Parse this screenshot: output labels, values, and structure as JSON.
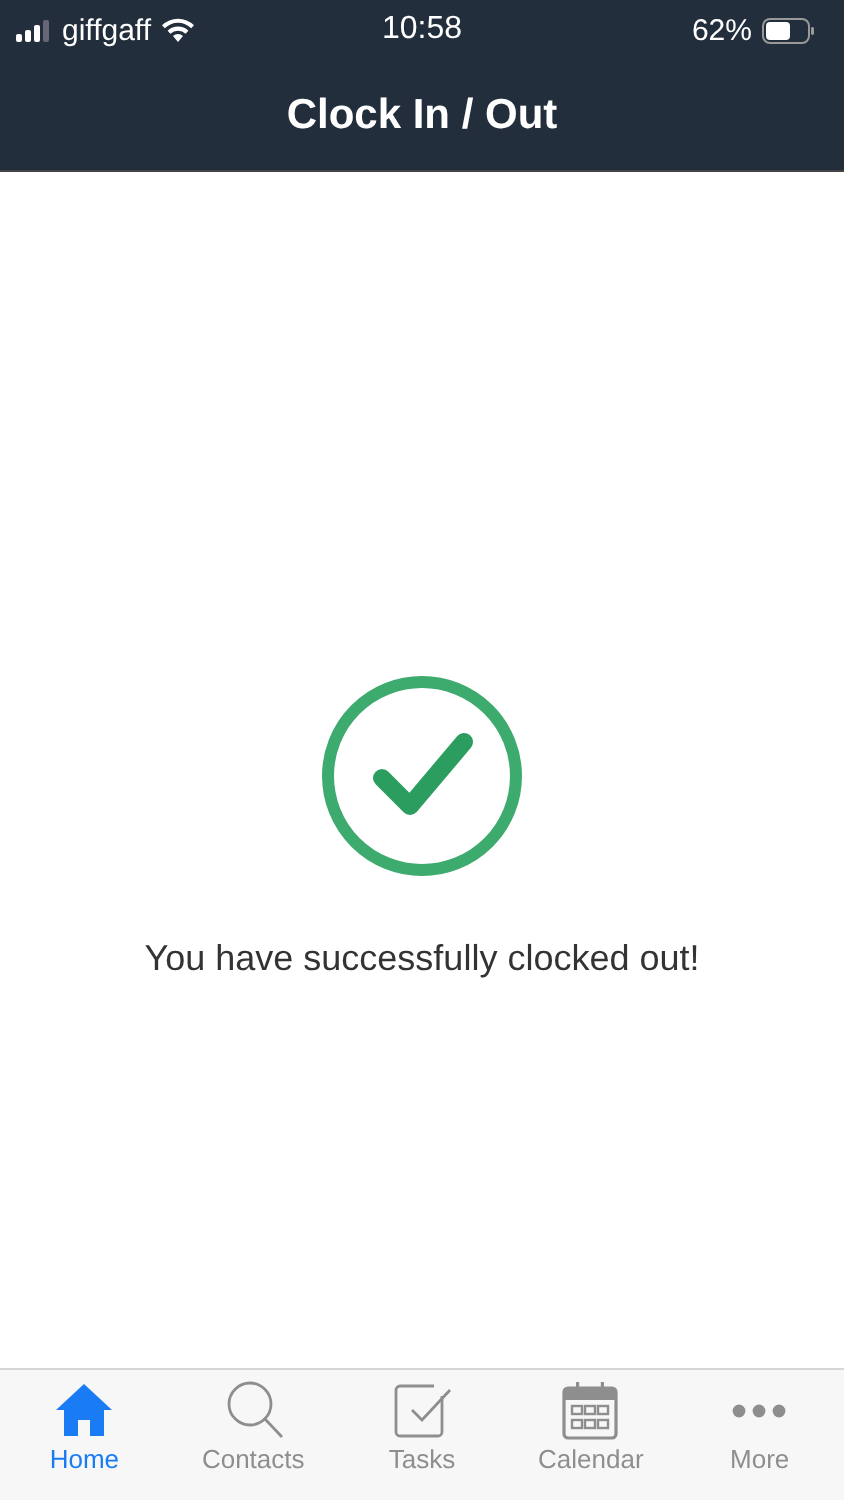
{
  "status_bar": {
    "carrier": "giffgaff",
    "time": "10:58",
    "battery": "62%"
  },
  "header": {
    "title": "Clock In / Out"
  },
  "message": "You have successfully clocked out!",
  "tabs": [
    {
      "label": "Home",
      "kind": "home",
      "selected": true
    },
    {
      "label": "Contacts",
      "kind": "search",
      "selected": false
    },
    {
      "label": "Tasks",
      "kind": "tasks",
      "selected": false
    },
    {
      "label": "Calendar",
      "kind": "calendar",
      "selected": false
    },
    {
      "label": "More",
      "kind": "more",
      "selected": false
    }
  ]
}
